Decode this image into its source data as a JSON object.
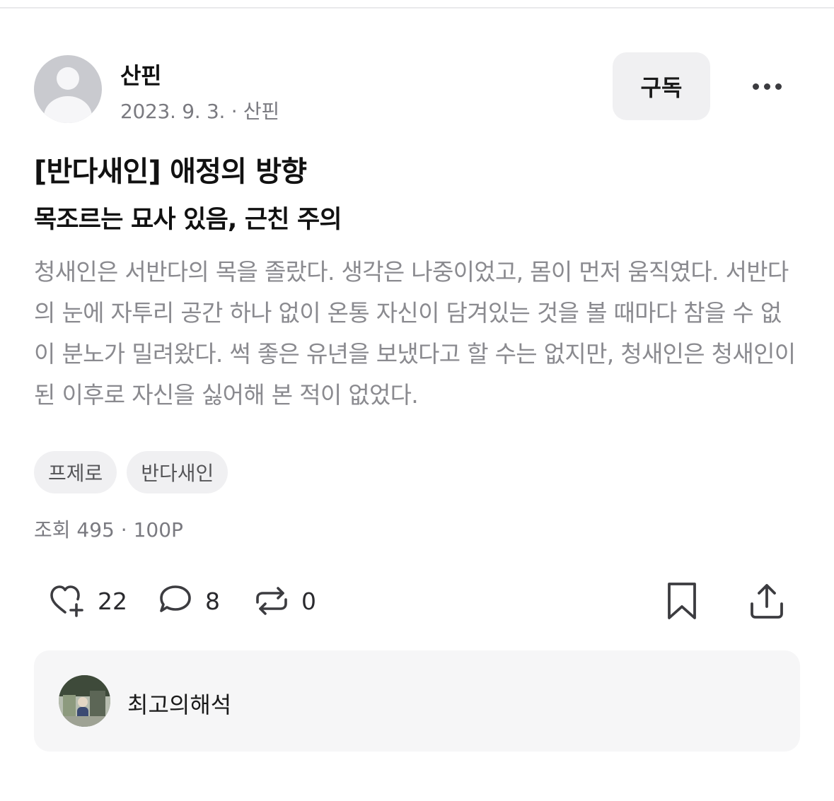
{
  "post": {
    "author": "산핀",
    "meta": "2023. 9. 3. · 산핀",
    "subscribe_label": "구독",
    "title": "[반다새인] 애정의 방향",
    "subtitle": "목조르는 묘사 있음, 근친 주의",
    "excerpt": "청새인은 서반다의 목을 졸랐다. 생각은 나중이었고, 몸이 먼저 움직였다. 서반다의 눈에 자투리 공간 하나 없이 온통 자신이 담겨있는 것을 볼 때마다 참을 수 없이 분노가 밀려왔다. 썩 좋은 유년을 보냈다고 할 수는 없지만, 청새인은 청새인이 된 이후로 자신을 싫어해 본 적이 없었다.",
    "tags": [
      "프제로",
      "반다새인"
    ],
    "stats": "조회 495 · 100P"
  },
  "actions": {
    "likes": "22",
    "comments": "8",
    "reposts": "0"
  },
  "comment": {
    "username": "최고의해석"
  },
  "colors": {
    "muted_text": "#8a8a8f",
    "chip_bg": "#f0f0f2",
    "card_bg": "#f6f6f7",
    "icon": "#3c3c40"
  }
}
